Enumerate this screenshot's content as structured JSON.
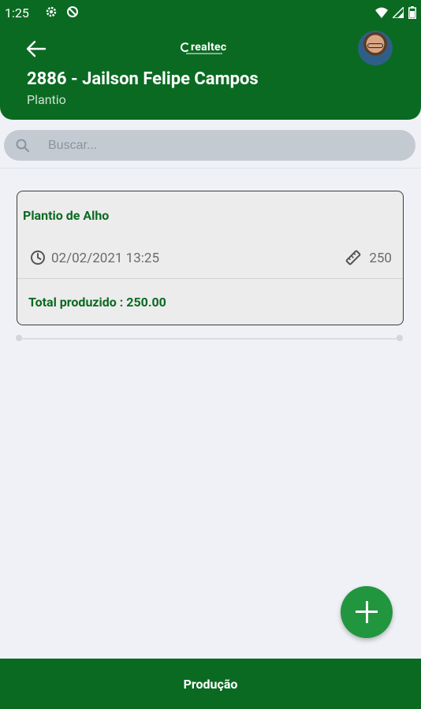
{
  "status_bar": {
    "time": "1:25",
    "icons": [
      "gear-icon",
      "dnd-icon",
      "wifi-icon",
      "signal-icon",
      "battery-icon"
    ]
  },
  "header": {
    "logo_text": "realtec",
    "title": "2886 - Jailson Felipe Campos",
    "subtitle": "Plantio",
    "bg_color": "#0b6a22"
  },
  "search": {
    "placeholder": "Buscar..."
  },
  "cards": [
    {
      "title": "Plantio de Alho",
      "datetime": "02/02/2021 13:25",
      "quantity": "250",
      "total_label": "Total produzido : 250.00"
    }
  ],
  "fab": {
    "icon": "plus-icon",
    "color": "#22963f"
  },
  "bottom_nav": {
    "label": "Produção"
  }
}
